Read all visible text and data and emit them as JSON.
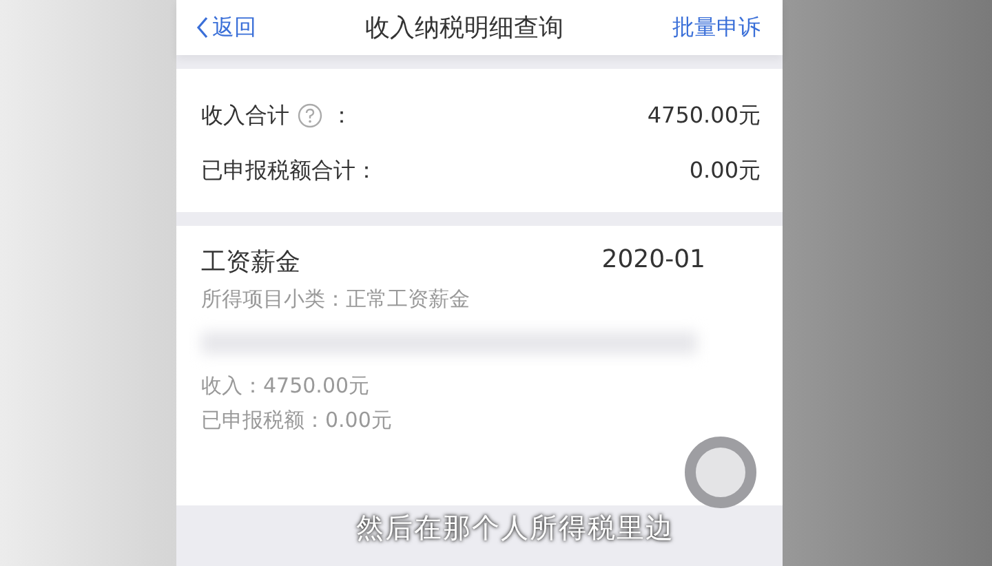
{
  "header": {
    "back": "返回",
    "title": "收入纳税明细查询",
    "action": "批量申诉"
  },
  "summary": [
    {
      "label": "收入合计",
      "help": true,
      "colon": "：",
      "value": "4750.00元"
    },
    {
      "label": "已申报税额合计：",
      "help": false,
      "value": "0.00元"
    }
  ],
  "record": {
    "title": "工资薪金",
    "period": "2020-01",
    "subtype": "所得项目小类：正常工资薪金",
    "income": "收入：4750.00元",
    "tax": "已申报税额：0.00元"
  },
  "subtitle": "然后在那个人所得税里边"
}
